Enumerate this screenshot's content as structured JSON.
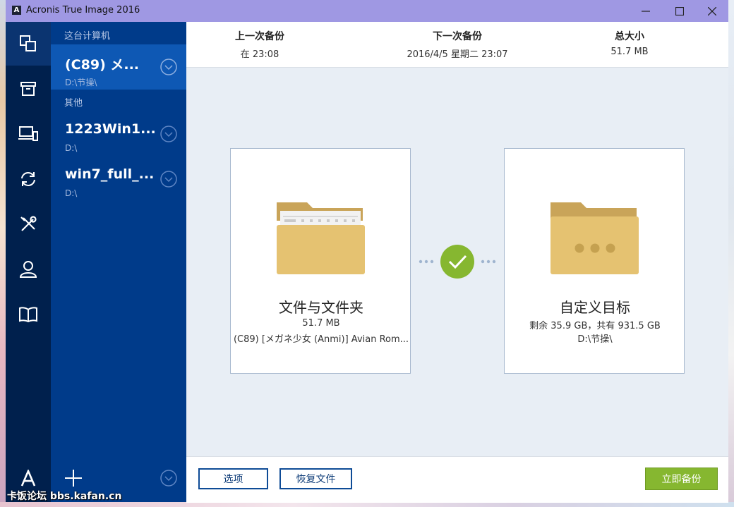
{
  "window": {
    "title": "Acronis True Image 2016",
    "logo_letter": "A"
  },
  "rail": {
    "items": [
      {
        "name": "backup",
        "icon": "copy-icon"
      },
      {
        "name": "archive",
        "icon": "archive-box-icon"
      },
      {
        "name": "devices",
        "icon": "devices-icon"
      },
      {
        "name": "sync",
        "icon": "sync-icon"
      },
      {
        "name": "tools",
        "icon": "tools-icon"
      },
      {
        "name": "account",
        "icon": "user-icon"
      },
      {
        "name": "help",
        "icon": "book-icon"
      }
    ],
    "brand": "A"
  },
  "backup_list": {
    "group_this_pc": "这台计算机",
    "group_other": "其他",
    "items": [
      {
        "name": "(C89) メ...",
        "path": "D:\\节操\\"
      },
      {
        "name": "1223Win1...",
        "path": "D:\\"
      },
      {
        "name": "win7_full_...",
        "path": "D:\\"
      }
    ]
  },
  "stats": {
    "last_label": "上一次备份",
    "last_value": "在 23:08",
    "next_label": "下一次备份",
    "next_value": "2016/4/5 星期二 23:07",
    "size_label": "总大小",
    "size_value": "51.7 MB"
  },
  "source": {
    "title": "文件与文件夹",
    "size": "51.7 MB",
    "name": "(C89) [メガネ少女 (Anmi)] Avian Rom..."
  },
  "destination": {
    "title": "自定义目标",
    "space": "剩余 35.9 GB，共有 931.5 GB",
    "path": "D:\\节操\\"
  },
  "footer": {
    "options_label": "选项",
    "restore_label": "恢复文件",
    "backup_now_label": "立即备份"
  },
  "watermark": "卡饭论坛 bbs.kafan.cn",
  "colors": {
    "titlebar": "#9f98e3",
    "rail": "#00204d",
    "list": "#003b8a",
    "list_active": "#0e58b4",
    "accent_green": "#86b730",
    "folder": "#e5c271"
  }
}
